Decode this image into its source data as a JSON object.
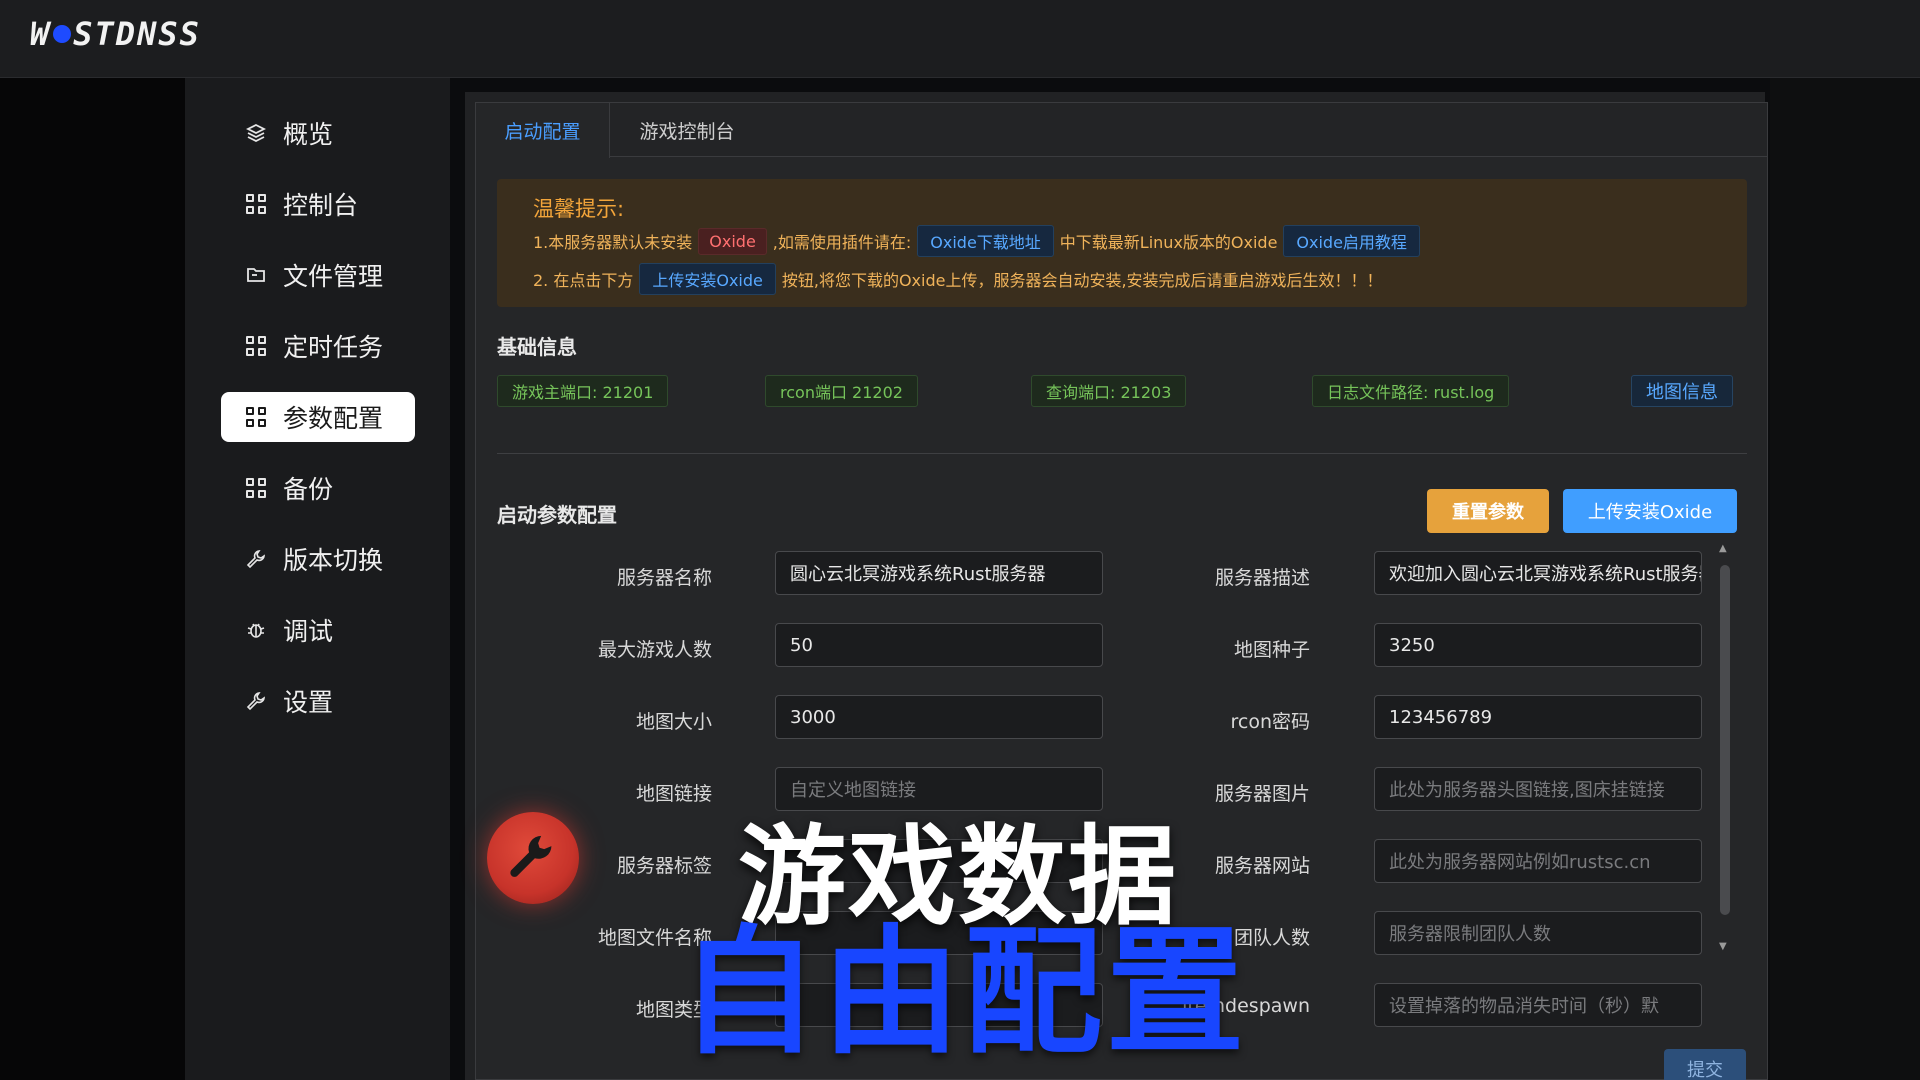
{
  "app": {
    "logo_text": "WSTDNSS"
  },
  "sidebar": {
    "items": [
      {
        "label": "概览",
        "icon": "layers-icon"
      },
      {
        "label": "控制台",
        "icon": "grid-icon"
      },
      {
        "label": "文件管理",
        "icon": "folder-icon"
      },
      {
        "label": "定时任务",
        "icon": "grid-icon"
      },
      {
        "label": "参数配置",
        "icon": "grid-icon",
        "active": true
      },
      {
        "label": "备份",
        "icon": "grid-icon"
      },
      {
        "label": "版本切换",
        "icon": "wrench-icon"
      },
      {
        "label": "调试",
        "icon": "bug-icon"
      },
      {
        "label": "设置",
        "icon": "wrench-icon"
      }
    ]
  },
  "tabs": [
    {
      "label": "启动配置",
      "active": true
    },
    {
      "label": "游戏控制台",
      "active": false
    }
  ],
  "notice": {
    "title": "温馨提示:",
    "line1_a": "1.本服务器默认未安装",
    "line1_tag1": "Oxide",
    "line1_b": ",如需使用插件请在:",
    "line1_tag2": "Oxide下载地址",
    "line1_c": "中下载最新Linux版本的Oxide",
    "line1_tag3": "Oxide启用教程",
    "line2_a": "2. 在点击下方",
    "line2_tag": "上传安装Oxide",
    "line2_b": "按钮,将您下载的Oxide上传，服务器会自动安装,安装完成后请重启游戏后生效！！！"
  },
  "basic_info": {
    "title": "基础信息",
    "tags": [
      "游戏主端口: 21201",
      "rcon端口 21202",
      "查询端口: 21203",
      "日志文件路径: rust.log"
    ],
    "map_info": "地图信息"
  },
  "startup": {
    "title": "启动参数配置",
    "reset_label": "重置参数",
    "upload_label": "上传安装Oxide",
    "submit_label": "提交",
    "left_fields": [
      {
        "label": "服务器名称",
        "value": "圆心云北冥游戏系统Rust服务器",
        "placeholder": ""
      },
      {
        "label": "最大游戏人数",
        "value": "50",
        "placeholder": ""
      },
      {
        "label": "地图大小",
        "value": "3000",
        "placeholder": ""
      },
      {
        "label": "地图链接",
        "value": "",
        "placeholder": "自定义地图链接"
      },
      {
        "label": "服务器标签",
        "value": "",
        "placeholder": ""
      },
      {
        "label": "地图文件名称",
        "value": "",
        "placeholder": ""
      },
      {
        "label": "地图类型",
        "value": "",
        "placeholder": ""
      }
    ],
    "right_fields": [
      {
        "label": "服务器描述",
        "value": "欢迎加入圆心云北冥游戏系统Rust服务器",
        "placeholder": ""
      },
      {
        "label": "地图种子",
        "value": "3250",
        "placeholder": ""
      },
      {
        "label": "rcon密码",
        "value": "123456789",
        "placeholder": ""
      },
      {
        "label": "服务器图片",
        "value": "",
        "placeholder": "此处为服务器头图链接,图床挂链接"
      },
      {
        "label": "服务器网站",
        "value": "",
        "placeholder": "此处为服务器网站例如rustsc.cn"
      },
      {
        "label": "团队人数",
        "value": "",
        "placeholder": "服务器限制团队人数"
      },
      {
        "label": "itemdespawn",
        "value": "",
        "placeholder": "设置掉落的物品消失时间（秒）默"
      }
    ]
  },
  "overlay": {
    "line1": "游戏数据",
    "line2": "自由配置"
  },
  "colors": {
    "accent_blue": "#409eff",
    "warning_orange": "#e6a23c",
    "overlay_blue": "#1846ff"
  }
}
